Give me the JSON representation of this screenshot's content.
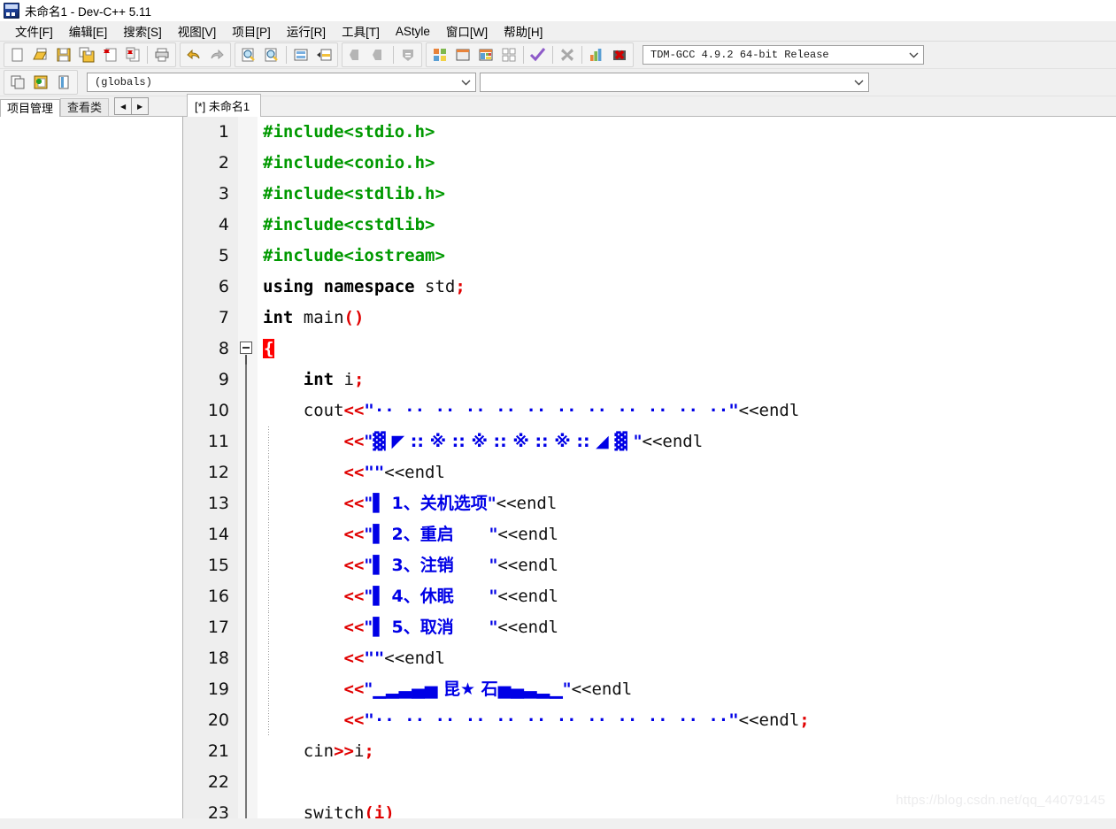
{
  "window": {
    "title": "未命名1 - Dev-C++ 5.11",
    "icon": "devcpp-app-icon"
  },
  "menubar": {
    "items": [
      {
        "label": "文件[F]",
        "name": "menu-file"
      },
      {
        "label": "编辑[E]",
        "name": "menu-edit"
      },
      {
        "label": "搜索[S]",
        "name": "menu-search"
      },
      {
        "label": "视图[V]",
        "name": "menu-view"
      },
      {
        "label": "项目[P]",
        "name": "menu-project"
      },
      {
        "label": "运行[R]",
        "name": "menu-run"
      },
      {
        "label": "工具[T]",
        "name": "menu-tools"
      },
      {
        "label": "AStyle",
        "name": "menu-astyle"
      },
      {
        "label": "窗口[W]",
        "name": "menu-window"
      },
      {
        "label": "帮助[H]",
        "name": "menu-help"
      }
    ]
  },
  "toolbar": {
    "group1": [
      {
        "icon": "new-file-icon",
        "name": "toolbar-new-file"
      },
      {
        "icon": "open-file-icon",
        "name": "toolbar-open-file"
      },
      {
        "icon": "save-icon",
        "name": "toolbar-save"
      },
      {
        "icon": "save-all-icon",
        "name": "toolbar-save-all"
      },
      {
        "icon": "close-file-icon",
        "name": "toolbar-close-file"
      },
      {
        "icon": "close-all-icon",
        "name": "toolbar-close-all"
      },
      {
        "icon": "print-icon",
        "name": "toolbar-print"
      }
    ],
    "group2": [
      {
        "icon": "undo-icon",
        "name": "toolbar-undo"
      },
      {
        "icon": "redo-icon",
        "name": "toolbar-redo"
      }
    ],
    "group3": [
      {
        "icon": "find-icon",
        "name": "toolbar-find"
      },
      {
        "icon": "replace-icon",
        "name": "toolbar-replace"
      },
      {
        "icon": "goto-line-icon",
        "name": "toolbar-goto-line"
      },
      {
        "icon": "goto-function-icon",
        "name": "toolbar-goto-function"
      }
    ],
    "group4": [
      {
        "icon": "back-icon",
        "name": "toolbar-back"
      },
      {
        "icon": "forward-icon",
        "name": "toolbar-forward"
      },
      {
        "icon": "bookmark-icon",
        "name": "toolbar-bookmark"
      }
    ],
    "group5": [
      {
        "icon": "compile-icon",
        "name": "toolbar-compile"
      },
      {
        "icon": "run-icon",
        "name": "toolbar-run"
      },
      {
        "icon": "compile-run-icon",
        "name": "toolbar-compile-run"
      },
      {
        "icon": "rebuild-all-icon",
        "name": "toolbar-rebuild-all"
      },
      {
        "icon": "syntax-check-icon",
        "name": "toolbar-syntax-check"
      },
      {
        "icon": "stop-icon",
        "name": "toolbar-stop"
      },
      {
        "icon": "profile-icon",
        "name": "toolbar-profile"
      },
      {
        "icon": "debug-delete-icon",
        "name": "toolbar-debug-delete"
      }
    ],
    "compiler_select": {
      "value": "TDM-GCC 4.9.2 64-bit Release",
      "arrow": "chevron-down-icon"
    }
  },
  "toolbar2": {
    "buttons": [
      {
        "icon": "new-project-icon",
        "name": "toolbar-new-project"
      },
      {
        "icon": "add-to-project-icon",
        "name": "toolbar-add-to-project"
      },
      {
        "icon": "project-options-icon",
        "name": "toolbar-project-options"
      }
    ],
    "scope_select": {
      "value": "(globals)",
      "arrow": "chevron-down-icon"
    },
    "symbol_select": {
      "value": "",
      "arrow": "chevron-down-icon"
    }
  },
  "left_panel": {
    "tabs": [
      {
        "label": "项目管理",
        "active": true,
        "name": "tab-project-manager"
      },
      {
        "label": "查看类",
        "active": false,
        "name": "tab-class-browser"
      }
    ],
    "nav": [
      {
        "glyph": "◀",
        "name": "tab-scroll-left-button"
      },
      {
        "glyph": "▶",
        "name": "tab-scroll-right-button"
      }
    ]
  },
  "editor": {
    "tabs": [
      {
        "label": "[*] 未命名1",
        "active": true,
        "name": "editor-tab-untitled1"
      }
    ],
    "lines": [
      {
        "n": "1",
        "fold": "none",
        "tokens": [
          {
            "c": "t-pre",
            "s": "#include<stdio.h>"
          }
        ]
      },
      {
        "n": "2",
        "fold": "none",
        "tokens": [
          {
            "c": "t-pre",
            "s": "#include<conio.h>"
          }
        ]
      },
      {
        "n": "3",
        "fold": "none",
        "tokens": [
          {
            "c": "t-pre",
            "s": "#include<stdlib.h>"
          }
        ]
      },
      {
        "n": "4",
        "fold": "none",
        "tokens": [
          {
            "c": "t-pre",
            "s": "#include<cstdlib>"
          }
        ]
      },
      {
        "n": "5",
        "fold": "none",
        "tokens": [
          {
            "c": "t-pre",
            "s": "#include<iostream>"
          }
        ]
      },
      {
        "n": "6",
        "fold": "none",
        "tokens": [
          {
            "c": "t-key",
            "s": "using namespace "
          },
          {
            "c": "t-plain",
            "s": "std"
          },
          {
            "c": "t-op",
            "s": ";"
          }
        ]
      },
      {
        "n": "7",
        "fold": "none",
        "tokens": [
          {
            "c": "t-key",
            "s": "int "
          },
          {
            "c": "t-plain",
            "s": "main"
          },
          {
            "c": "t-op",
            "s": "()"
          }
        ]
      },
      {
        "n": "8",
        "fold": "open",
        "tokens": [
          {
            "c": "t-brace-hl",
            "s": "{"
          }
        ]
      },
      {
        "n": "9",
        "fold": "line",
        "tokens": [
          {
            "c": "t-plain",
            "s": "    "
          },
          {
            "c": "t-key",
            "s": "int "
          },
          {
            "c": "t-plain",
            "s": "i"
          },
          {
            "c": "t-op",
            "s": ";"
          }
        ]
      },
      {
        "n": "10",
        "fold": "line",
        "tokens": [
          {
            "c": "t-plain",
            "s": "    cout"
          },
          {
            "c": "t-op",
            "s": "<<"
          },
          {
            "c": "t-str",
            "s": "\"·· ·· ·· ·· ·· ·· ·· ·· ·· ·· ·· ··\""
          },
          {
            "c": "t-plain",
            "s": "<<endl"
          }
        ]
      },
      {
        "n": "11",
        "fold": "dotted",
        "tokens": [
          {
            "c": "t-plain",
            "s": "        "
          },
          {
            "c": "t-op",
            "s": "<<"
          },
          {
            "c": "t-str",
            "s": "\"▓ ◤ :: ※ :: ※ :: ※ :: ※ :: ◢ ▓ \""
          },
          {
            "c": "t-plain",
            "s": "<<endl"
          }
        ]
      },
      {
        "n": "12",
        "fold": "dotted",
        "tokens": [
          {
            "c": "t-plain",
            "s": "        "
          },
          {
            "c": "t-op",
            "s": "<<"
          },
          {
            "c": "t-str",
            "s": "\"\""
          },
          {
            "c": "t-plain",
            "s": "<<endl"
          }
        ]
      },
      {
        "n": "13",
        "fold": "dotted",
        "tokens": [
          {
            "c": "t-plain",
            "s": "        "
          },
          {
            "c": "t-op",
            "s": "<<"
          },
          {
            "c": "t-str",
            "s": "\"▌ 1、关机选项\""
          },
          {
            "c": "t-plain",
            "s": "<<endl"
          }
        ]
      },
      {
        "n": "14",
        "fold": "dotted",
        "tokens": [
          {
            "c": "t-plain",
            "s": "        "
          },
          {
            "c": "t-op",
            "s": "<<"
          },
          {
            "c": "t-str",
            "s": "\"▌ 2、重启      \""
          },
          {
            "c": "t-plain",
            "s": "<<endl"
          }
        ]
      },
      {
        "n": "15",
        "fold": "dotted",
        "tokens": [
          {
            "c": "t-plain",
            "s": "        "
          },
          {
            "c": "t-op",
            "s": "<<"
          },
          {
            "c": "t-str",
            "s": "\"▌ 3、注销      \""
          },
          {
            "c": "t-plain",
            "s": "<<endl"
          }
        ]
      },
      {
        "n": "16",
        "fold": "dotted",
        "tokens": [
          {
            "c": "t-plain",
            "s": "        "
          },
          {
            "c": "t-op",
            "s": "<<"
          },
          {
            "c": "t-str",
            "s": "\"▌ 4、休眠      \""
          },
          {
            "c": "t-plain",
            "s": "<<endl"
          }
        ]
      },
      {
        "n": "17",
        "fold": "dotted",
        "tokens": [
          {
            "c": "t-plain",
            "s": "        "
          },
          {
            "c": "t-op",
            "s": "<<"
          },
          {
            "c": "t-str",
            "s": "\"▌ 5、取消      \""
          },
          {
            "c": "t-plain",
            "s": "<<endl"
          }
        ]
      },
      {
        "n": "18",
        "fold": "dotted",
        "tokens": [
          {
            "c": "t-plain",
            "s": "        "
          },
          {
            "c": "t-op",
            "s": "<<"
          },
          {
            "c": "t-str",
            "s": "\"\""
          },
          {
            "c": "t-plain",
            "s": "<<endl"
          }
        ]
      },
      {
        "n": "19",
        "fold": "dotted",
        "tokens": [
          {
            "c": "t-plain",
            "s": "        "
          },
          {
            "c": "t-op",
            "s": "<<"
          },
          {
            "c": "t-str",
            "s": "\"▁▂▃▄▅ 昆★ 石▅▄▃▂▁\""
          },
          {
            "c": "t-plain",
            "s": "<<endl"
          }
        ]
      },
      {
        "n": "20",
        "fold": "dotted",
        "tokens": [
          {
            "c": "t-plain",
            "s": "        "
          },
          {
            "c": "t-op",
            "s": "<<"
          },
          {
            "c": "t-str",
            "s": "\"·· ·· ·· ·· ·· ·· ·· ·· ·· ·· ·· ··\""
          },
          {
            "c": "t-plain",
            "s": "<<endl"
          },
          {
            "c": "t-op",
            "s": ";"
          }
        ]
      },
      {
        "n": "21",
        "fold": "line",
        "tokens": [
          {
            "c": "t-plain",
            "s": "    cin"
          },
          {
            "c": "t-op",
            "s": ">>"
          },
          {
            "c": "t-plain",
            "s": "i"
          },
          {
            "c": "t-op",
            "s": ";"
          }
        ]
      },
      {
        "n": "22",
        "fold": "line",
        "tokens": [
          {
            "c": "t-plain",
            "s": ""
          }
        ]
      },
      {
        "n": "23",
        "fold": "line",
        "tokens": [
          {
            "c": "t-plain",
            "s": "    switch"
          },
          {
            "c": "t-op",
            "s": "(i)"
          }
        ]
      }
    ]
  },
  "watermark": {
    "text": "https://blog.csdn.net/qq_44079145"
  },
  "colors": {
    "preprocessor": "#009900",
    "string": "#0000e6",
    "operator": "#e00000",
    "brace_highlight_bg": "#ff0000",
    "gutter_bg": "#eeeeee",
    "chrome_bg": "#f0f0f0"
  }
}
